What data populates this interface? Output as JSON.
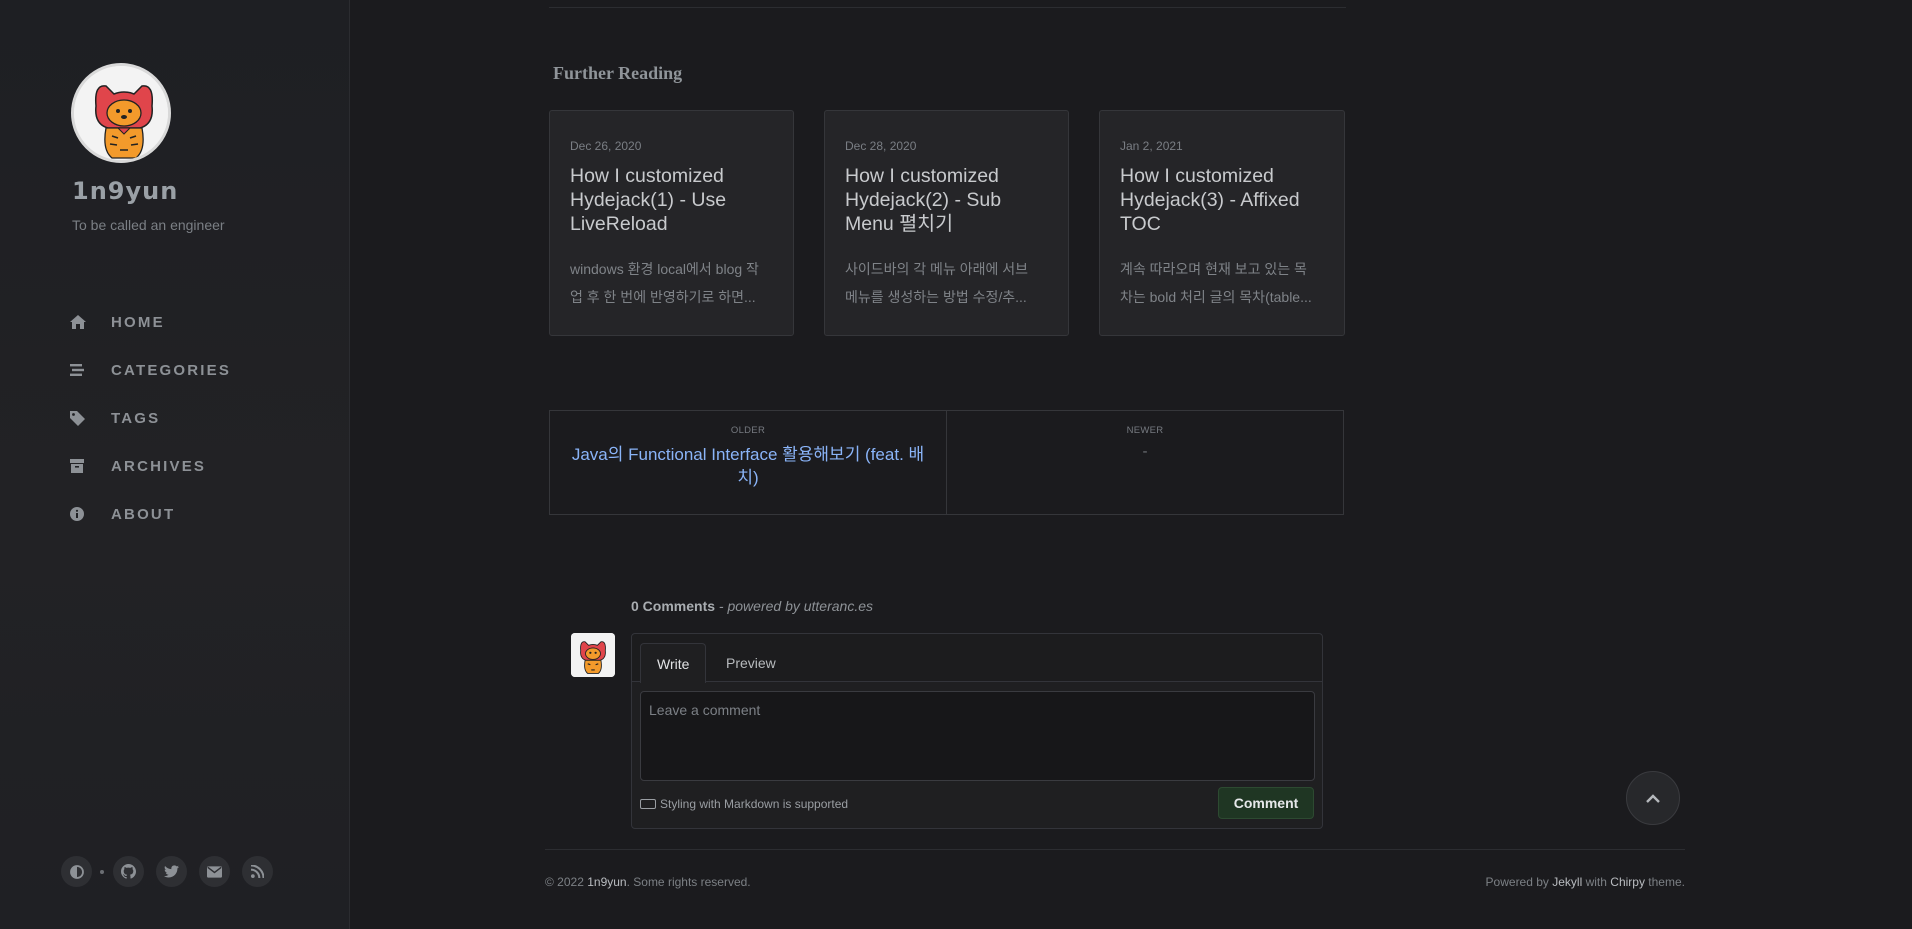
{
  "sidebar": {
    "title": "1n9yun",
    "subtitle": "To be called an engineer",
    "nav": [
      {
        "label": "HOME",
        "icon": "home-icon"
      },
      {
        "label": "CATEGORIES",
        "icon": "stream-icon"
      },
      {
        "label": "TAGS",
        "icon": "tag-icon"
      },
      {
        "label": "ARCHIVES",
        "icon": "archive-icon"
      },
      {
        "label": "ABOUT",
        "icon": "info-circle-icon"
      }
    ],
    "bottom_icons": [
      "theme-toggle-icon",
      "github-icon",
      "twitter-icon",
      "email-icon",
      "rss-icon"
    ]
  },
  "further_reading": {
    "title": "Further Reading",
    "cards": [
      {
        "date": "Dec 26, 2020",
        "title": "How I customized Hydejack(1) - Use LiveReload",
        "excerpt": [
          "windows 환경 local에서 blog 작",
          "업 후 한 번에 반영하기로 하면..."
        ]
      },
      {
        "date": "Dec 28, 2020",
        "title": "How I customized Hydejack(2) - Sub Menu 펼치기",
        "excerpt": [
          "사이드바의 각 메뉴 아래에 서브",
          "메뉴를 생성하는 방법 수정/추..."
        ]
      },
      {
        "date": "Jan 2, 2021",
        "title": "How I customized Hydejack(3) - Affixed TOC",
        "excerpt": [
          "계속 따라오며 현재 보고 있는 목",
          "차는 bold 처리 글의 목차(table..."
        ]
      }
    ]
  },
  "pager": {
    "older_label": "OLDER",
    "older_title": "Java의 Functional Interface 활용해보기 (feat. 배치)",
    "newer_label": "NEWER",
    "newer_title": "-"
  },
  "comments": {
    "count_text": "0 Comments",
    "powered_text": "- powered by utteranc.es",
    "tab_write": "Write",
    "tab_preview": "Preview",
    "placeholder": "Leave a comment",
    "markdown_note": "Styling with Markdown is supported",
    "submit_label": "Comment"
  },
  "footer": {
    "copyright_prefix": "© 2022 ",
    "copyright_name": "1n9yun",
    "copyright_suffix": ". Some rights reserved.",
    "powered_prefix": "Powered by ",
    "jekyll": "Jekyll",
    "with": " with ",
    "chirpy": "Chirpy",
    "theme": " theme."
  },
  "colors": {
    "background": "#1b1b1e",
    "sidebar": "#202124",
    "link": "#8ab4f8",
    "comment_button": "#1f3623"
  }
}
